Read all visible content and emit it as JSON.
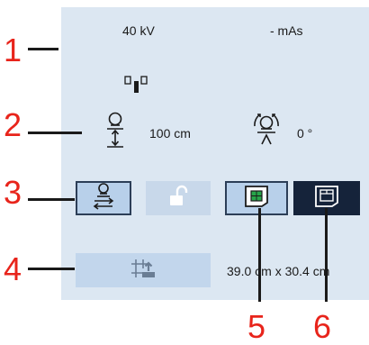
{
  "status": {
    "kv": "40 kV",
    "mas": "- mAs"
  },
  "geometry": {
    "distance": "100 cm",
    "angle": "0 °"
  },
  "field_size": "39.0 cm x 30.4 cm",
  "callouts": [
    "1",
    "2",
    "3",
    "4",
    "5",
    "6"
  ],
  "colors": {
    "panel_bg": "#dce7f2",
    "callout_red": "#e8241b",
    "button_dark": "#15233a",
    "button_light": "#b8d0ea"
  },
  "icons": {
    "focal_spot": "focal-spot-icon",
    "tube_height": "tube-height-icon",
    "tube_rotation": "tube-rotation-icon",
    "tube_center": "tube-center-icon",
    "lock": "unlock-icon",
    "detector_small": "detector-small-icon",
    "detector_large": "detector-large-icon",
    "collimator": "collimator-icon"
  }
}
